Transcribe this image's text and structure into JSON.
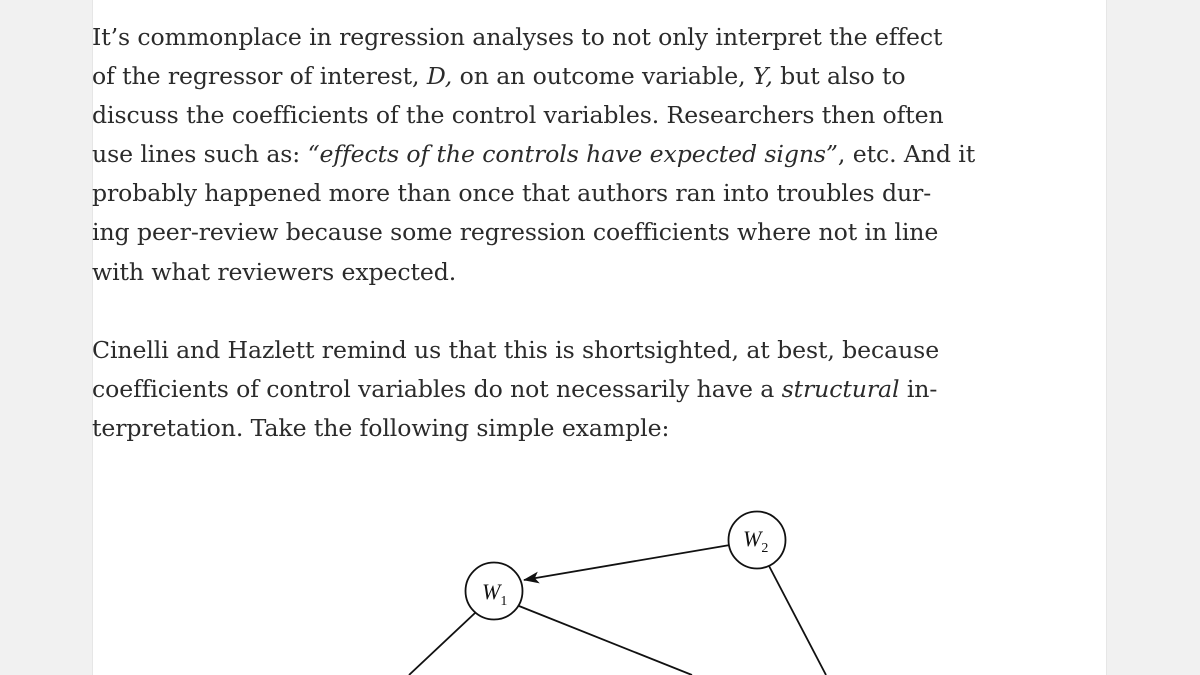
{
  "paragraph1": {
    "l1": "It’s commonplace in regression analyses to not only interpret the effect",
    "l2_pre": "of the regressor of interest, ",
    "l2_D": "D,",
    "l2_mid": " on an outcome variable, ",
    "l2_Y": "Y,",
    "l2_post": " but also to",
    "l3": "discuss the coefficients of the control variables. Researchers then often",
    "l4_pre": "use lines such as: ",
    "l4_quote": "“effects of the controls have expected signs”",
    "l4_post": ", etc. And it",
    "l5": "probably happened more than once that authors ran into troubles dur-",
    "l6": "ing peer-review because some regression coefficients where not in line",
    "l7": "with what reviewers expected."
  },
  "paragraph2": {
    "l1": "Cinelli and Hazlett remind us that this is shortsighted, at best, because",
    "l2_pre": "coefficients of control variables do not necessarily have a ",
    "l2_em": "structural",
    "l2_post": " in-",
    "l3": "terpretation. Take the following simple example:"
  },
  "diagram": {
    "nodes": {
      "w1": {
        "label": "W",
        "sub": "1"
      },
      "w2": {
        "label": "W",
        "sub": "2"
      }
    },
    "edges": [
      "W2 → W1",
      "W1 → (below)",
      "W1 → (below right)",
      "W2 → (below)"
    ]
  }
}
